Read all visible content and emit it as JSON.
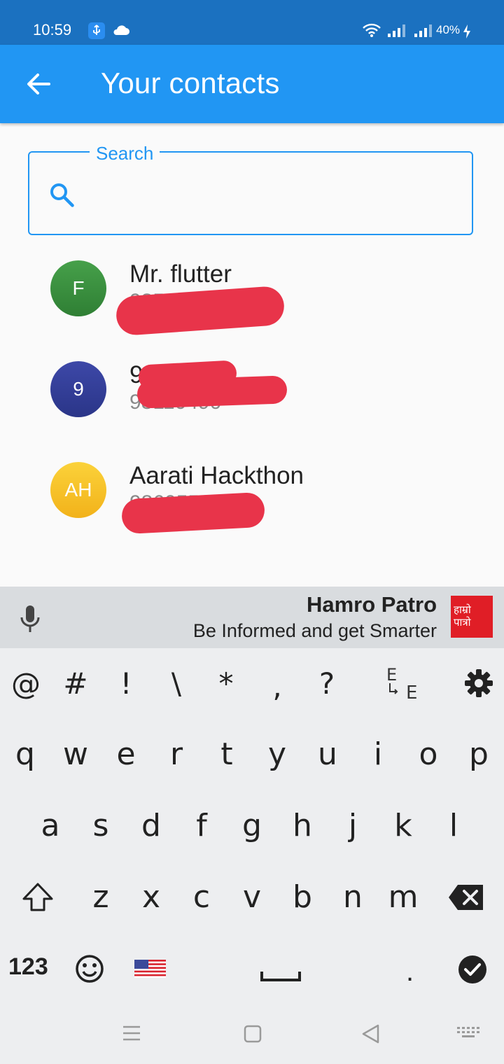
{
  "status_bar": {
    "time": "10:59",
    "battery": "40%"
  },
  "app_bar": {
    "title": "Your contacts",
    "back_icon": "arrow-left-icon"
  },
  "search": {
    "label": "Search",
    "value": "",
    "icon": "search-icon"
  },
  "contacts": [
    {
      "initials": "F",
      "name": "Mr. flutter",
      "phone": "98512",
      "avatar_color": "#3a8f3e"
    },
    {
      "initials": "9",
      "name": "98 40",
      "phone": "98110490",
      "avatar_color": "#333f9b"
    },
    {
      "initials": "AH",
      "name": "Aarati Hackthon",
      "phone": "98605591",
      "avatar_color": "#f6c025"
    }
  ],
  "suggestion_strip": {
    "ad_title": "Hamro Patro",
    "ad_subtitle": "Be Informed and get Smarter",
    "logo_text_1": "हाम्रो",
    "logo_text_2": "पात्रो"
  },
  "keyboard": {
    "symbols": [
      "@",
      "#",
      "!",
      "\\",
      "*",
      ",",
      "?"
    ],
    "row1": [
      "q",
      "w",
      "e",
      "r",
      "t",
      "y",
      "u",
      "i",
      "o",
      "p"
    ],
    "row2": [
      "a",
      "s",
      "d",
      "f",
      "g",
      "h",
      "j",
      "k",
      "l"
    ],
    "row3": [
      "z",
      "x",
      "c",
      "v",
      "b",
      "n",
      "m"
    ],
    "numbers_key": "123",
    "period_key": "."
  },
  "colors": {
    "primary": "#2196f3",
    "status_bar": "#1b71c0",
    "redaction": "#e8344a"
  }
}
